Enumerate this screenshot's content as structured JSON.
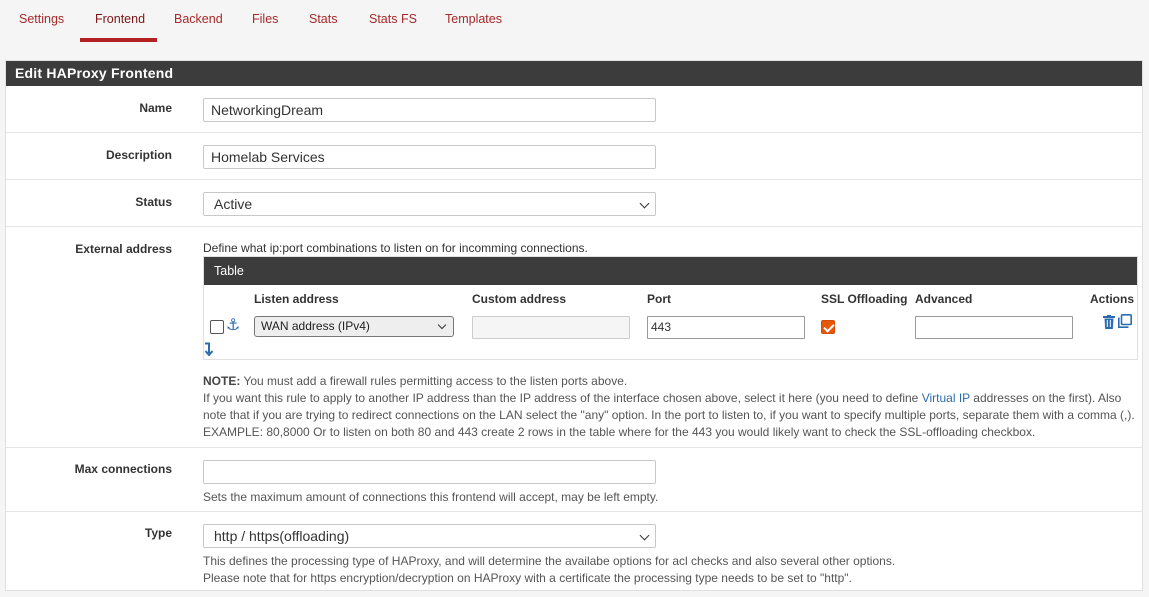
{
  "tabs": [
    "Settings",
    "Frontend",
    "Backend",
    "Files",
    "Stats",
    "Stats FS",
    "Templates"
  ],
  "active_tab": "Frontend",
  "panel": {
    "title": "Edit HAProxy Frontend"
  },
  "fields": {
    "name": {
      "label": "Name",
      "value": "NetworkingDream"
    },
    "description": {
      "label": "Description",
      "value": "Homelab Services"
    },
    "status": {
      "label": "Status",
      "value": "Active"
    },
    "external_address": {
      "label": "External address",
      "intro": "Define what ip:port combinations to listen on for incomming connections.",
      "table": {
        "title": "Table",
        "columns": [
          "Listen address",
          "Custom address",
          "Port",
          "SSL Offloading",
          "Advanced",
          "Actions"
        ],
        "rows": [
          {
            "listen_address": "WAN address (IPv4)",
            "custom_address": "",
            "port": "443",
            "ssl_offloading": true,
            "advanced": ""
          }
        ]
      },
      "note_label": "NOTE:",
      "note_line1": " You must add a firewall rules permitting access to the listen ports above.",
      "note_line2_a": "If you want this rule to apply to another IP address than the IP address of the interface chosen above, select it here (you need to define ",
      "note_line2_link": "Virtual IP",
      "note_line2_b": " addresses on the first). Also",
      "note_line3": "note that if you are trying to redirect connections on the LAN select the \"any\" option. In the port to listen to, if you want to specify multiple ports, separate them with a comma (,).",
      "note_line4": "EXAMPLE: 80,8000 Or to listen on both 80 and 443 create 2 rows in the table where for the 443 you would likely want to check the SSL-offloading checkbox."
    },
    "max_connections": {
      "label": "Max connections",
      "value": "",
      "help": "Sets the maximum amount of connections this frontend will accept, may be left empty."
    },
    "type": {
      "label": "Type",
      "value": "http / https(offloading)",
      "help1": "This defines the processing type of HAProxy, and will determine the availabe options for acl checks and also several other options.",
      "help2": "Please note that for https encryption/decryption on HAProxy with a certificate the processing type needs to be set to \"http\"."
    }
  },
  "icons": {
    "anchor": "anchor-icon",
    "move_down": "move-down-icon",
    "delete": "trash-icon",
    "copy": "copy-icon"
  },
  "colors": {
    "tab_text": "#a52a2a",
    "tab_active_underline": "#b22222",
    "heading_bg": "#3c3c3c",
    "link": "#2b6cb0",
    "checkbox_checked": "#e8580c"
  }
}
